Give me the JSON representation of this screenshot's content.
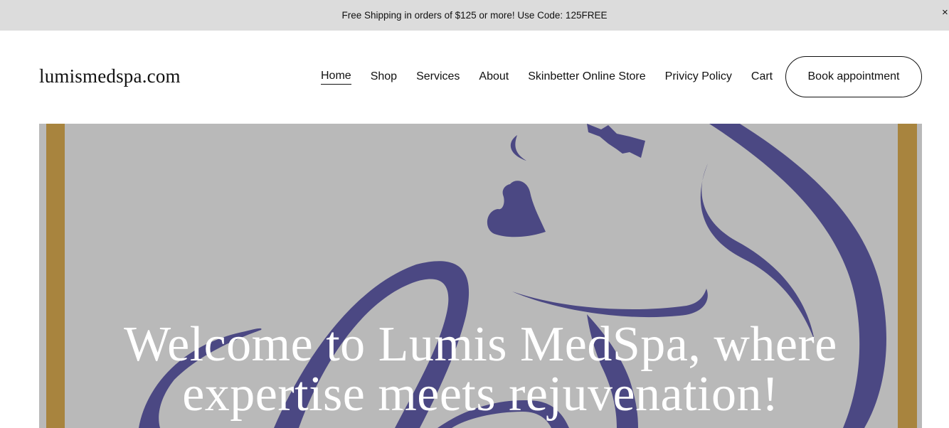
{
  "announcement": {
    "text": "Free Shipping in orders of $125 or more! Use Code: 125FREE",
    "close_glyph": "×"
  },
  "header": {
    "logo": "lumismedspa.com",
    "nav": [
      {
        "label": "Home",
        "active": true
      },
      {
        "label": "Shop"
      },
      {
        "label": "Services"
      },
      {
        "label": "About"
      },
      {
        "label": "Skinbetter Online Store"
      },
      {
        "label": "Privicy Policy"
      },
      {
        "label": "Cart"
      }
    ],
    "cta_label": "Book appointment"
  },
  "hero": {
    "title_line1": "Welcome to Lumis MedSpa, where",
    "title_line2": "expertise meets rejuvenation!",
    "colors": {
      "background": "#b9b9b9",
      "frame": "#a8843e",
      "art": "#4b4883",
      "text": "#ffffff"
    },
    "art_icon": "face-line-art-logo"
  }
}
